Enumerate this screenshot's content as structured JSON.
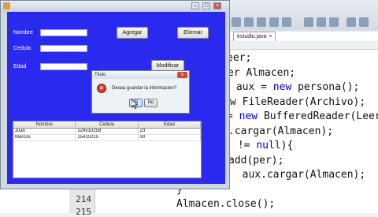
{
  "ide": {
    "tab_label": "estudio.java",
    "line_numbers": [
      "214",
      "215"
    ],
    "code_lines": [
      {
        "prefix": "",
        "parts": [
          {
            "t": "eer;",
            "c": ""
          }
        ]
      },
      {
        "prefix": "",
        "parts": [
          {
            "t": "er Almacen;",
            "c": ""
          }
        ]
      },
      {
        "prefix": "",
        "parts": [
          {
            "t": " aux = ",
            "c": ""
          },
          {
            "t": "new",
            "c": "kw"
          },
          {
            "t": " persona();",
            "c": ""
          }
        ]
      },
      {
        "prefix": "",
        "parts": [
          {
            "t": "w FileReader(Archivo);",
            "c": ""
          }
        ]
      },
      {
        "prefix": "",
        "parts": [
          {
            "t": "= ",
            "c": ""
          },
          {
            "t": "new",
            "c": "kw"
          },
          {
            "t": " BufferedReader(Leer",
            "c": ""
          }
        ]
      },
      {
        "prefix": "",
        "parts": [
          {
            "t": ".cargar(Almacen);",
            "c": ""
          }
        ]
      },
      {
        "prefix": "",
        "parts": [
          {
            "t": " != ",
            "c": ""
          },
          {
            "t": "null",
            "c": "kw"
          },
          {
            "t": "){",
            "c": ""
          }
        ]
      },
      {
        "prefix": "",
        "parts": [
          {
            "t": "add(per);",
            "c": ""
          }
        ]
      },
      {
        "prefix": "",
        "parts": [
          {
            "t": "  aux.cargar(Almacen);",
            "c": ""
          }
        ]
      },
      {
        "prefix": "",
        "parts": [
          {
            "t": "}",
            "c": ""
          }
        ]
      },
      {
        "prefix": "",
        "parts": [
          {
            "t": "Almacen.close();",
            "c": ""
          }
        ]
      }
    ]
  },
  "window": {
    "labels": {
      "nombre": "Nombre",
      "cedula": "Cedula",
      "edad": "Edad"
    },
    "buttons": {
      "agregar": "Agregar",
      "eliminar": "Elimnar",
      "modificar": "Modificar"
    },
    "table": {
      "headers": [
        "Nombre",
        "Cedula",
        "Edad"
      ],
      "rows": [
        [
          "Juan",
          "124510258",
          "23"
        ],
        [
          "Marcos",
          "15410215",
          "30"
        ]
      ]
    }
  },
  "dialog": {
    "title": "Titulo",
    "close": "x",
    "message": "Desea guardar la informacion?",
    "yes": "Si",
    "no": "No"
  },
  "colors": {
    "panel_bg": "#2a2aee",
    "error_icon": "#d43a2a"
  }
}
